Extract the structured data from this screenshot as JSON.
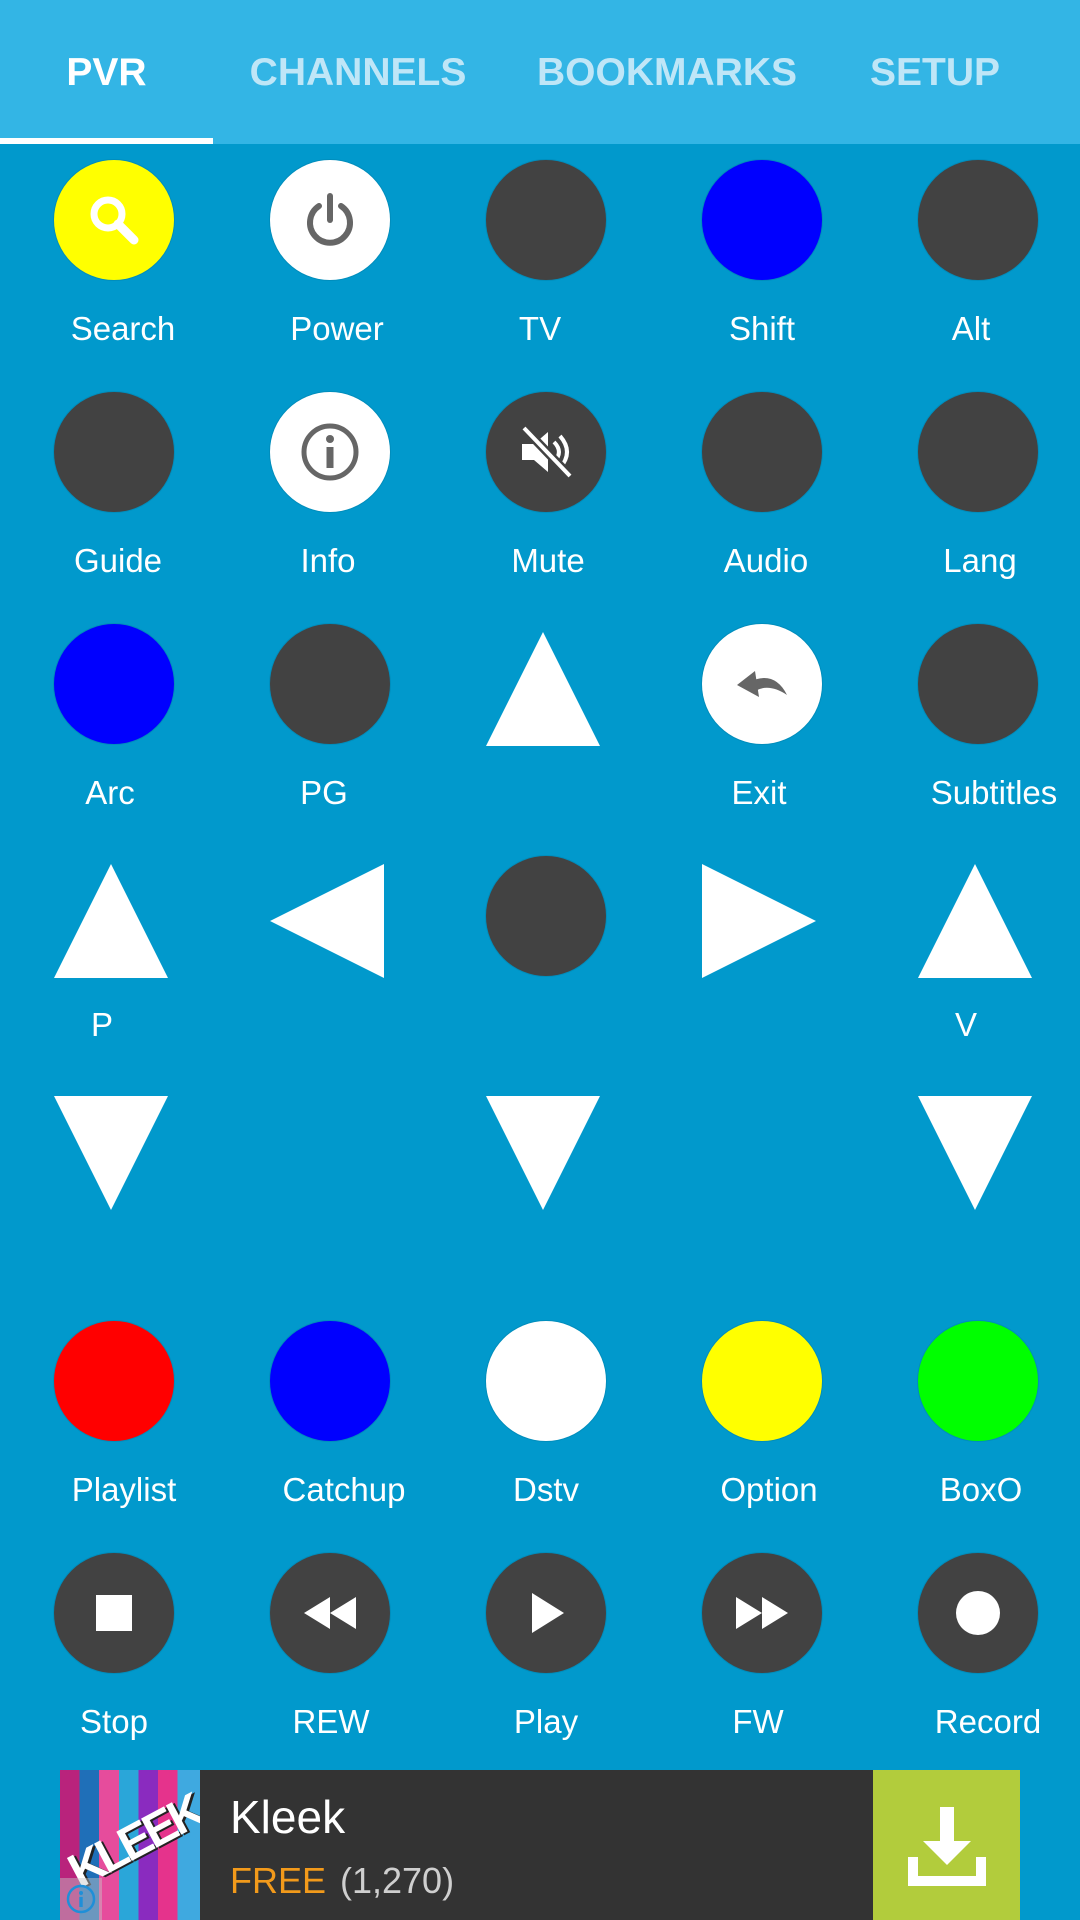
{
  "tabs": [
    {
      "label": "PVR",
      "active": true
    },
    {
      "label": "CHANNELS",
      "active": false
    },
    {
      "label": "BOOKMARKS",
      "active": false
    },
    {
      "label": "SETUP",
      "active": false
    }
  ],
  "colors": {
    "background": "#0199cc",
    "tab_bar": "#33b5e5",
    "dark_button": "#424242",
    "yellow": "#ffff00",
    "blue": "#0000ff",
    "white": "#ffffff",
    "red": "#ff0000",
    "green": "#00ff00"
  },
  "buttons": {
    "search": {
      "label": "Search",
      "icon": "search-icon"
    },
    "power": {
      "label": "Power",
      "icon": "power-icon"
    },
    "tv": {
      "label": "TV"
    },
    "shift": {
      "label": "Shift"
    },
    "alt": {
      "label": "Alt"
    },
    "guide": {
      "label": "Guide"
    },
    "info": {
      "label": "Info",
      "icon": "info-icon"
    },
    "mute": {
      "label": "Mute",
      "icon": "mute-icon"
    },
    "audio": {
      "label": "Audio"
    },
    "lang": {
      "label": "Lang"
    },
    "arc": {
      "label": "Arc"
    },
    "pg": {
      "label": "PG"
    },
    "exit": {
      "label": "Exit",
      "icon": "undo-icon"
    },
    "subtitles": {
      "label": "Subtitles"
    },
    "program": {
      "label": "P"
    },
    "volume": {
      "label": "V"
    },
    "playlist": {
      "label": "Playlist"
    },
    "catchup": {
      "label": "Catchup"
    },
    "dstv": {
      "label": "Dstv"
    },
    "option": {
      "label": "Option"
    },
    "boxo": {
      "label": "BoxO"
    },
    "stop": {
      "label": "Stop",
      "icon": "stop-icon"
    },
    "rew": {
      "label": "REW",
      "icon": "rewind-icon"
    },
    "play": {
      "label": "Play",
      "icon": "play-icon"
    },
    "fw": {
      "label": "FW",
      "icon": "fast-forward-icon"
    },
    "record": {
      "label": "Record",
      "icon": "record-icon"
    }
  },
  "ad": {
    "logo_text": "KLEEK",
    "title": "Kleek",
    "price": "FREE",
    "rating_count": "(1,270)",
    "download_icon": "download-icon",
    "info_icon": "info-icon"
  }
}
